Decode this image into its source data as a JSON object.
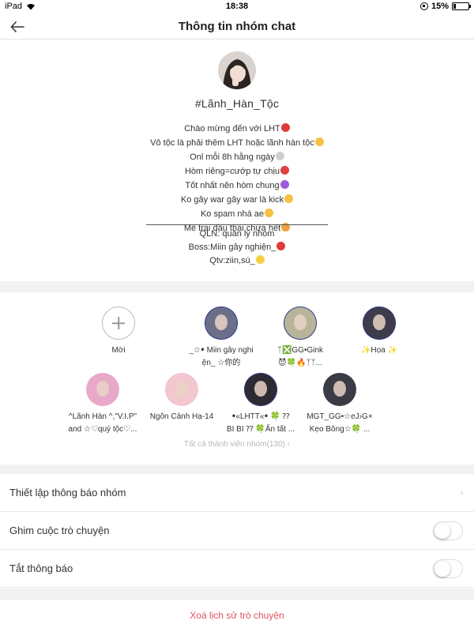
{
  "status_bar": {
    "device": "iPad",
    "time": "18:38",
    "battery": "15%",
    "battery_level": 0.15
  },
  "nav": {
    "title": "Thông tin nhóm chat",
    "back_icon": "arrow-left-icon"
  },
  "group": {
    "name": "#Lãnh_Hàn_Tộc",
    "description": [
      "Chào mừng đến với LHT",
      "Vô tộc là phải thêm LHT hoặc lãnh hàn tộc",
      "Onl mỗi 8h hằng ngày",
      "Hòm riêng=cướp tự chịu",
      "Tốt nhất nên hòm chung",
      "Ko gây war gây war là kick",
      "Ko spam nhá ae",
      "Mê trai đầu thai chưa hết"
    ],
    "description_emoji_colors": [
      "#e03a3a",
      "#f5c242",
      "#cfcfcf",
      "#e04040",
      "#a05ad8",
      "#f5c242",
      "#f5c242",
      "#f0a040"
    ],
    "roles": [
      "QLN: quản lý nhóm",
      "Boss:Miin gây nghiện_",
      "Qtv:ziin,sú_"
    ],
    "role_emoji_colors": [
      "",
      "#e03a3a",
      "#f5d142"
    ]
  },
  "members": {
    "invite_label": "Mời",
    "list": [
      {
        "name_line1": "_☆ꔷ Miin gây nghi",
        "name_line2": "ện_ ☆你的",
        "avatar_color": "#6b6f8a",
        "framed": true
      },
      {
        "name_line1": "ᛉ❎GG•Gink",
        "name_line2": "😈🍀🔥ᛉᛉ...",
        "avatar_color": "#b7b49a",
        "framed": true
      },
      {
        "name_line1": "✨Họa ✨",
        "name_line2": "",
        "avatar_color": "#3e3c4a",
        "framed": true
      },
      {
        "name_line1": "^Lãnh Hàn ^,\"V.I.P\"",
        "name_line2": "and ☆♡quý tộc♡...",
        "avatar_color": "#e8a9c8",
        "framed": false
      },
      {
        "name_line1": "Ngôn Cảnh Hạ-14",
        "name_line2": "",
        "avatar_color": "#f2c7cf",
        "framed": false
      },
      {
        "name_line1": "ꔷ«LHTT«ꔷ 🍀 ⁇",
        "name_line2": "BI BI ⁇ 🍀Ẩn tất ...",
        "avatar_color": "#2e2a33",
        "framed": true
      },
      {
        "name_line1": "MGT_GG•☆eJ›G×",
        "name_line2": "Kẹo Bông☆🍀 ...",
        "avatar_color": "#3a3b44",
        "framed": false
      }
    ],
    "all_members_label": "Tất cả thành viên nhóm(130)"
  },
  "settings": {
    "notify_setup_label": "Thiết lập thông báo nhóm",
    "pin_label": "Ghim cuộc trò chuyện",
    "pin_on": false,
    "mute_label": "Tắt thông báo",
    "mute_on": false
  },
  "clear_history_label": "Xoá lịch sử trò chuyện"
}
